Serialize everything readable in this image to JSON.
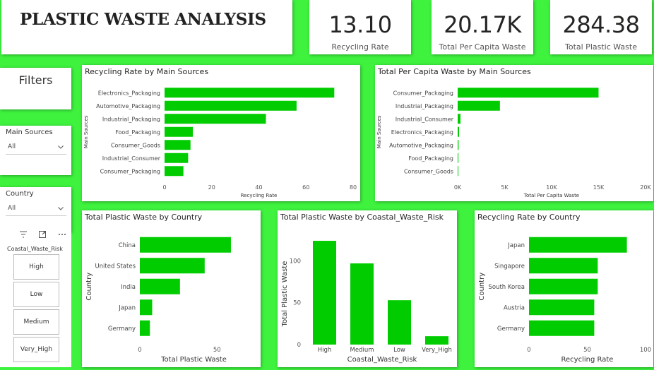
{
  "header": {
    "title": "PLASTIC WASTE ANALYSIS"
  },
  "kpis": [
    {
      "value": "13.10",
      "label": "Recycling Rate"
    },
    {
      "value": "20.17K",
      "label": "Total Per Capita Waste"
    },
    {
      "value": "284.38",
      "label": "Total Plastic Waste"
    }
  ],
  "filters": {
    "title": "Filters",
    "main_sources": {
      "label": "Main Sources",
      "value": "All"
    },
    "country": {
      "label": "Country",
      "value": "All"
    },
    "coastal_risk": {
      "label": "Coastal_Waste_Risk",
      "options": [
        "High",
        "Low",
        "Medium",
        "Very_High"
      ]
    }
  },
  "colors": {
    "bar": "#00cc00",
    "background": "#3ef23e",
    "icon": "filter-icon, focus-mode-icon, more-options-icon"
  },
  "chart_data": [
    {
      "id": "rr_sources",
      "type": "bar",
      "orientation": "horizontal",
      "title": "Recycling Rate by Main Sources",
      "xlabel": "Recycling Rate",
      "ylabel": "Main Sources",
      "categories": [
        "Electronics_Packaging",
        "Automotive_Packaging",
        "Industrial_Packaging",
        "Food_Packaging",
        "Consumer_Goods",
        "Industrial_Consumer",
        "Consumer_Packaging"
      ],
      "values": [
        72,
        56,
        43,
        12,
        11,
        10,
        8
      ],
      "xlim": [
        0,
        80
      ],
      "xticks": [
        "0",
        "20",
        "40",
        "60",
        "80"
      ]
    },
    {
      "id": "pc_sources",
      "type": "bar",
      "orientation": "horizontal",
      "title": "Total Per Capita Waste by Main Sources",
      "xlabel": "Total Per Capita Waste",
      "ylabel": "Main Sources",
      "categories": [
        "Consumer_Packaging",
        "Industrial_Packaging",
        "Industrial_Consumer",
        "Electronics_Packaging",
        "Automotive_Packaging",
        "Food_Packaging",
        "Consumer_Goods"
      ],
      "values": [
        15000,
        4500,
        300,
        150,
        100,
        80,
        40
      ],
      "xlim": [
        0,
        20000
      ],
      "xticks": [
        "0K",
        "5K",
        "10K",
        "15K",
        "20K"
      ]
    },
    {
      "id": "tpw_country",
      "type": "bar",
      "orientation": "horizontal",
      "title": "Total Plastic Waste by Country",
      "xlabel": "Total Plastic Waste",
      "ylabel": "Country",
      "categories": [
        "China",
        "United States",
        "India",
        "Japan",
        "Germany"
      ],
      "values": [
        59,
        42,
        26,
        8,
        6.5
      ],
      "xlim": [
        0,
        70
      ],
      "xticks": [
        "0",
        "50"
      ]
    },
    {
      "id": "tpw_risk",
      "type": "bar",
      "orientation": "vertical",
      "title": "Total Plastic Waste by Coastal_Waste_Risk",
      "xlabel": "Coastal_Waste_Risk",
      "ylabel": "Total Plastic Waste",
      "categories": [
        "High",
        "Medium",
        "Low",
        "Very_High"
      ],
      "values": [
        124,
        97,
        53,
        10
      ],
      "ylim": [
        0,
        135
      ],
      "yticks": [
        "0",
        "50",
        "100"
      ]
    },
    {
      "id": "rr_country",
      "type": "bar",
      "orientation": "horizontal",
      "title": "Recycling Rate by Country",
      "xlabel": "Recycling Rate",
      "ylabel": "Country",
      "categories": [
        "Japan",
        "Singapore",
        "South Korea",
        "Austria",
        "Germany"
      ],
      "values": [
        84,
        59,
        59,
        56,
        56
      ],
      "xlim": [
        0,
        100
      ],
      "xticks": [
        "0",
        "50",
        "100"
      ]
    }
  ]
}
